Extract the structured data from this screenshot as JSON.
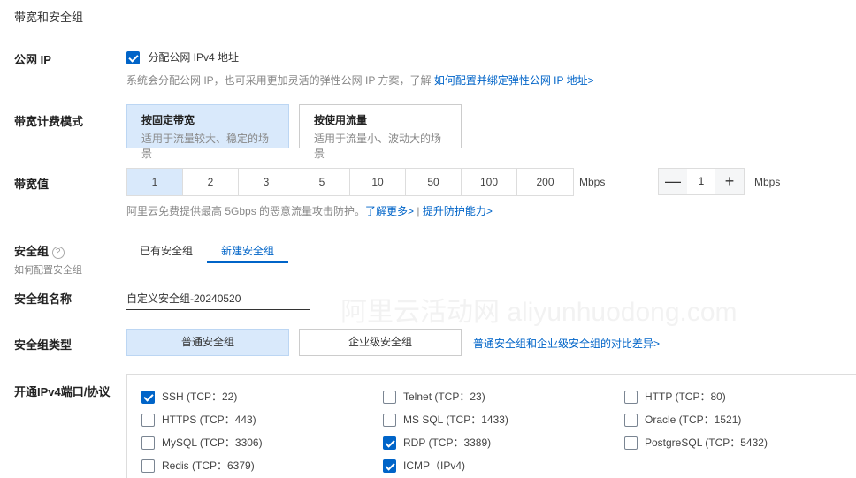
{
  "section_title": "带宽和安全组",
  "watermark": "阿里云活动网 aliyunhuodong.com",
  "public_ip": {
    "label": "公网 IP",
    "checkbox_label": "分配公网 IPv4 地址",
    "checked": true,
    "hint": "系统会分配公网 IP，也可采用更加灵活的弹性公网 IP 方案，了解 ",
    "hint_link": "如何配置并绑定弹性公网 IP 地址>"
  },
  "billing": {
    "label": "带宽计费模式",
    "options": [
      {
        "title": "按固定带宽",
        "desc": "适用于流量较大、稳定的场景",
        "selected": true
      },
      {
        "title": "按使用流量",
        "desc": "适用于流量小、波动大的场景",
        "selected": false
      }
    ]
  },
  "bandwidth": {
    "label": "带宽值",
    "options": [
      "1",
      "2",
      "3",
      "5",
      "10",
      "50",
      "100",
      "200"
    ],
    "selected": "1",
    "unit": "Mbps",
    "stepper_value": "1",
    "stepper_minus": "—",
    "stepper_plus": "+",
    "stepper_unit": "Mbps",
    "hint": "阿里云免费提供最高 5Gbps 的恶意流量攻击防护。",
    "link1": "了解更多>",
    "sep": " | ",
    "link2": "提升防护能力>"
  },
  "security_group": {
    "label": "安全组",
    "help_icon": "?",
    "sub": "如何配置安全组",
    "tabs": [
      "已有安全组",
      "新建安全组"
    ],
    "active_tab": "新建安全组"
  },
  "sg_name": {
    "label": "安全组名称",
    "value": "自定义安全组-20240520"
  },
  "sg_type": {
    "label": "安全组类型",
    "options": [
      "普通安全组",
      "企业级安全组"
    ],
    "selected": "普通安全组",
    "link": "普通安全组和企业级安全组的对比差异>"
  },
  "ports": {
    "label": "开通IPv4端口/协议",
    "items": [
      {
        "label": "SSH (TCP：22)",
        "checked": true
      },
      {
        "label": "Telnet (TCP：23)",
        "checked": false
      },
      {
        "label": "HTTP (TCP：80)",
        "checked": false
      },
      {
        "label": "HTTPS (TCP：443)",
        "checked": false
      },
      {
        "label": "MS SQL (TCP：1433)",
        "checked": false
      },
      {
        "label": "Oracle (TCP：1521)",
        "checked": false
      },
      {
        "label": "MySQL (TCP：3306)",
        "checked": false
      },
      {
        "label": "RDP (TCP：3389)",
        "checked": true
      },
      {
        "label": "PostgreSQL (TCP：5432)",
        "checked": false
      },
      {
        "label": "Redis (TCP：6379)",
        "checked": false
      },
      {
        "label": "ICMP（IPv4)",
        "checked": true
      }
    ]
  }
}
